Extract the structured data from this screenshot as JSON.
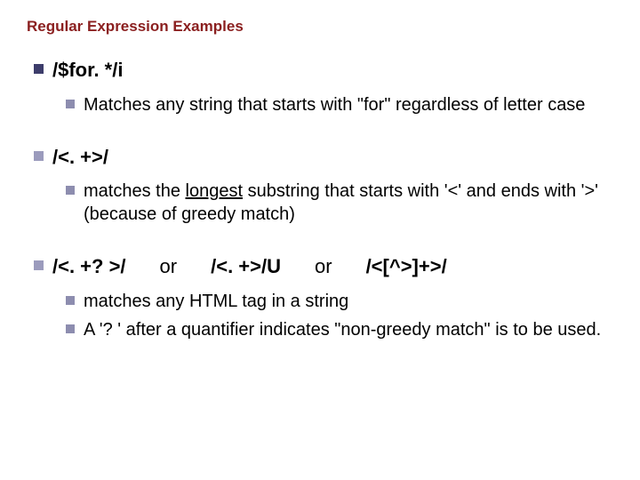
{
  "title": "Regular Expression Examples",
  "items": [
    {
      "pattern": "/$for. */i",
      "subs": [
        {
          "text": "Matches any string that starts with \"for\" regardless of letter case"
        }
      ]
    },
    {
      "pattern": "/<. +>/",
      "subs": [
        {
          "pre": " matches the ",
          "u": "longest",
          "post": " substring that starts with '<' and ends with '>' (because of greedy match)"
        }
      ]
    },
    {
      "pattern_parts": [
        "/<. +? >/",
        "or",
        "/<. +>/U",
        "or",
        "/<[^>]+>/"
      ],
      "subs": [
        {
          "text": "matches any HTML tag in a string"
        },
        {
          "text": "A '? ' after a quantifier indicates \"non-greedy match\" is to be used."
        }
      ]
    }
  ]
}
